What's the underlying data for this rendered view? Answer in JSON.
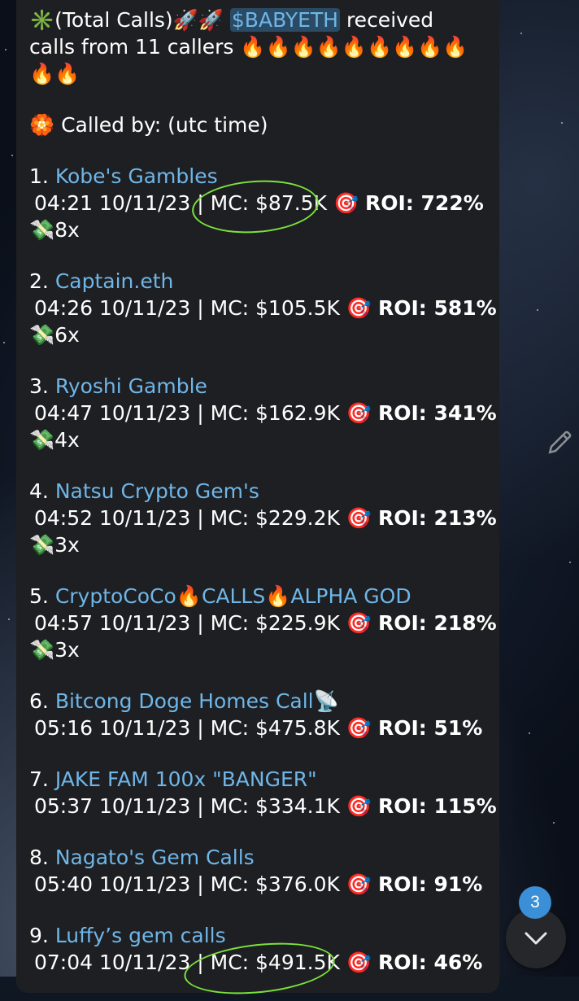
{
  "message": {
    "header": {
      "icon": "sparkle-icon",
      "title": "(Total Calls)",
      "rockets": "🚀🚀",
      "ticker": "$BABYETH",
      "received": "received",
      "callers_text": "calls from 11 callers",
      "fires_line1": "🔥🔥🔥🔥🔥🔥🔥🔥🔥",
      "fires_line2": "🔥🔥"
    },
    "called_by": {
      "icon": "🏵️",
      "label": "Called by: (utc time)"
    },
    "calls": [
      {
        "index": "1.",
        "caller": "Kobe's Gambles",
        "time": "04:21 10/11/23",
        "mc": "MC: $87.5K",
        "roi": "ROI: 722%",
        "multiplier": "8x"
      },
      {
        "index": "2.",
        "caller": "Captain.eth",
        "time": "04:26 10/11/23",
        "mc": "MC: $105.5K",
        "roi": "ROI: 581%",
        "multiplier": "6x"
      },
      {
        "index": "3.",
        "caller": "Ryoshi Gamble",
        "time": "04:47 10/11/23",
        "mc": "MC: $162.9K",
        "roi": "ROI: 341%",
        "multiplier": "4x"
      },
      {
        "index": "4.",
        "caller": "Natsu Crypto Gem's",
        "time": "04:52 10/11/23",
        "mc": "MC: $229.2K",
        "roi": "ROI: 213%",
        "multiplier": "3x"
      },
      {
        "index": "5.",
        "caller": "CryptoCoCo🔥CALLS🔥ALPHA GOD",
        "time": "04:57 10/11/23",
        "mc": "MC: $225.9K",
        "roi": "ROI: 218%",
        "multiplier": "3x"
      },
      {
        "index": "6.",
        "caller": "Bitcong Doge Homes Call📡",
        "time": "05:16 10/11/23",
        "mc": "MC: $475.8K",
        "roi": "ROI: 51%",
        "multiplier": ""
      },
      {
        "index": "7.",
        "caller": "JAKE FAM 100x \"BANGER\"",
        "time": "05:37 10/11/23",
        "mc": "MC: $334.1K",
        "roi": "ROI: 115%",
        "multiplier": ""
      },
      {
        "index": "8.",
        "caller": "Nagato's Gem Calls",
        "time": "05:40 10/11/23",
        "mc": "MC: $376.0K",
        "roi": "ROI: 91%",
        "multiplier": ""
      },
      {
        "index": "9.",
        "caller": "Luffy’s gem calls",
        "time": "07:04 10/11/23",
        "mc": "MC: $491.5K",
        "roi": "ROI: 46%",
        "multiplier": ""
      }
    ],
    "separator": "|",
    "target_emoji": "🎯",
    "money_emoji": "💸"
  },
  "scroll_button": {
    "icon": "chevron-down-icon",
    "unread_count": "3"
  },
  "edit_icon": "pencil-icon",
  "colors": {
    "link": "#6fb6e8",
    "bubble": "#1e1f22",
    "highlight_circle": "#7ae23a",
    "badge": "#3a8fd6"
  }
}
